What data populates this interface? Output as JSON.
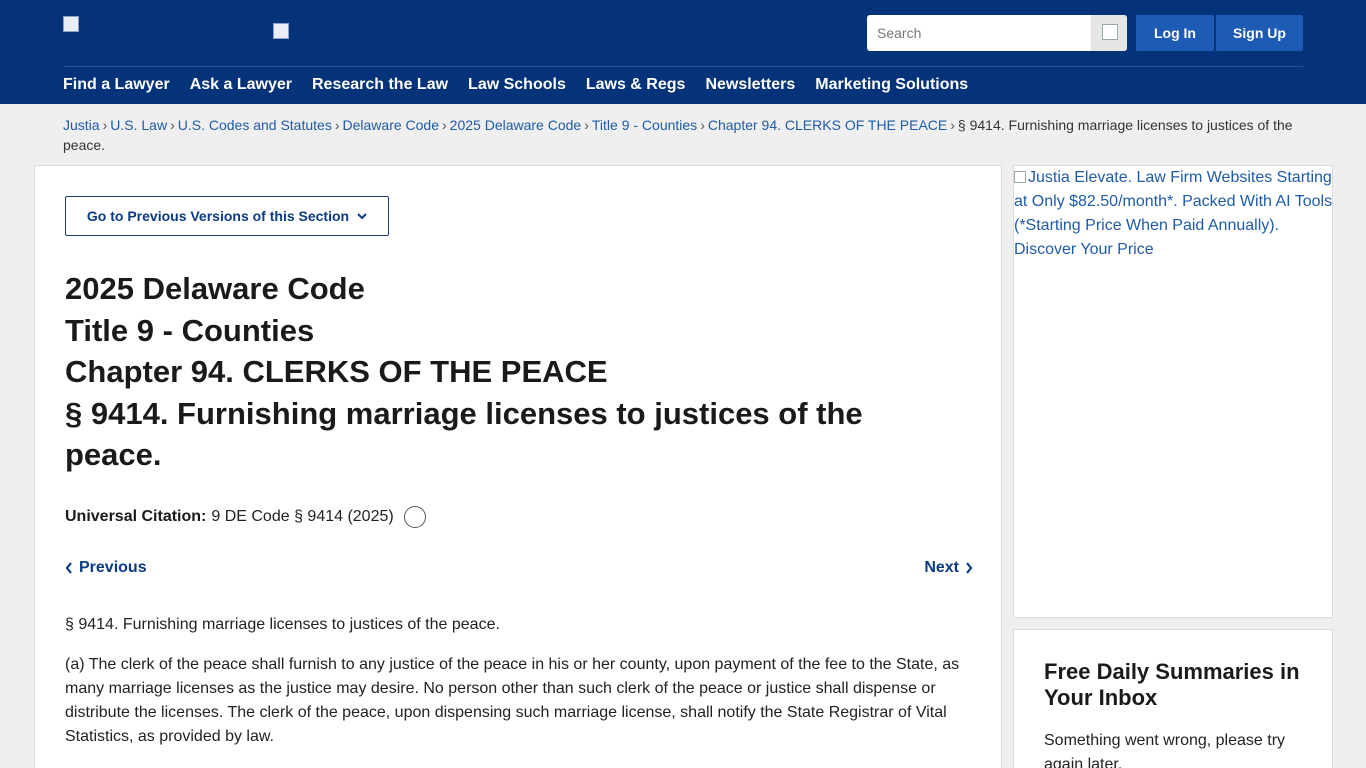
{
  "header": {
    "search": {
      "placeholder": "Search"
    },
    "login_label": "Log In",
    "signup_label": "Sign Up",
    "nav": [
      "Find a Lawyer",
      "Ask a Lawyer",
      "Research the Law",
      "Law Schools",
      "Laws & Regs",
      "Newsletters",
      "Marketing Solutions"
    ]
  },
  "breadcrumb": {
    "items": [
      "Justia",
      "U.S. Law",
      "U.S. Codes and Statutes",
      "Delaware Code",
      "2025 Delaware Code",
      "Title 9 - Counties",
      "Chapter 94. CLERKS OF THE PEACE"
    ],
    "current": "§ 9414. Furnishing marriage licenses to justices of the peace.",
    "separator": "›"
  },
  "main": {
    "versions_button": "Go to Previous Versions of this Section",
    "title": {
      "code": "2025 Delaware Code",
      "title_line": "Title 9 - Counties",
      "chapter": "Chapter 94. CLERKS OF THE PEACE",
      "section": "§ 9414. Furnishing marriage licenses to justices of the peace."
    },
    "citation": {
      "label": "Universal Citation:",
      "value": "9 DE Code § 9414 (2025)"
    },
    "previous_label": "Previous",
    "next_label": "Next",
    "content": {
      "heading": "§ 9414. Furnishing marriage licenses to justices of the peace.",
      "paragraph_a": "(a) The clerk of the peace shall furnish to any justice of the peace in his or her county, upon payment of the fee to the State, as many marriage licenses as the justice may desire. No person other than such clerk of the peace or justice shall dispense or distribute the licenses. The clerk of the peace, upon dispensing such marriage license, shall notify the State Registrar of Vital Statistics, as provided by law."
    }
  },
  "sidebar": {
    "ad_alt": "Justia Elevate. Law Firm Websites Starting at Only $82.50/month*. Packed With AI Tools (*Starting Price When Paid Annually). Discover Your Price",
    "newsletter": {
      "title": "Free Daily Summaries in Your Inbox",
      "message": "Something went wrong, please try again later."
    }
  },
  "colors": {
    "header_bg": "#05337a",
    "button_bg": "#1e5bb5",
    "link": "#1f5ba9",
    "accent_text": "#0c3b84"
  },
  "icons": [
    "logo-image-icon",
    "search-icon",
    "chevron-down-icon",
    "copy-citation-icon",
    "chevron-left-icon",
    "chevron-right-icon"
  ]
}
